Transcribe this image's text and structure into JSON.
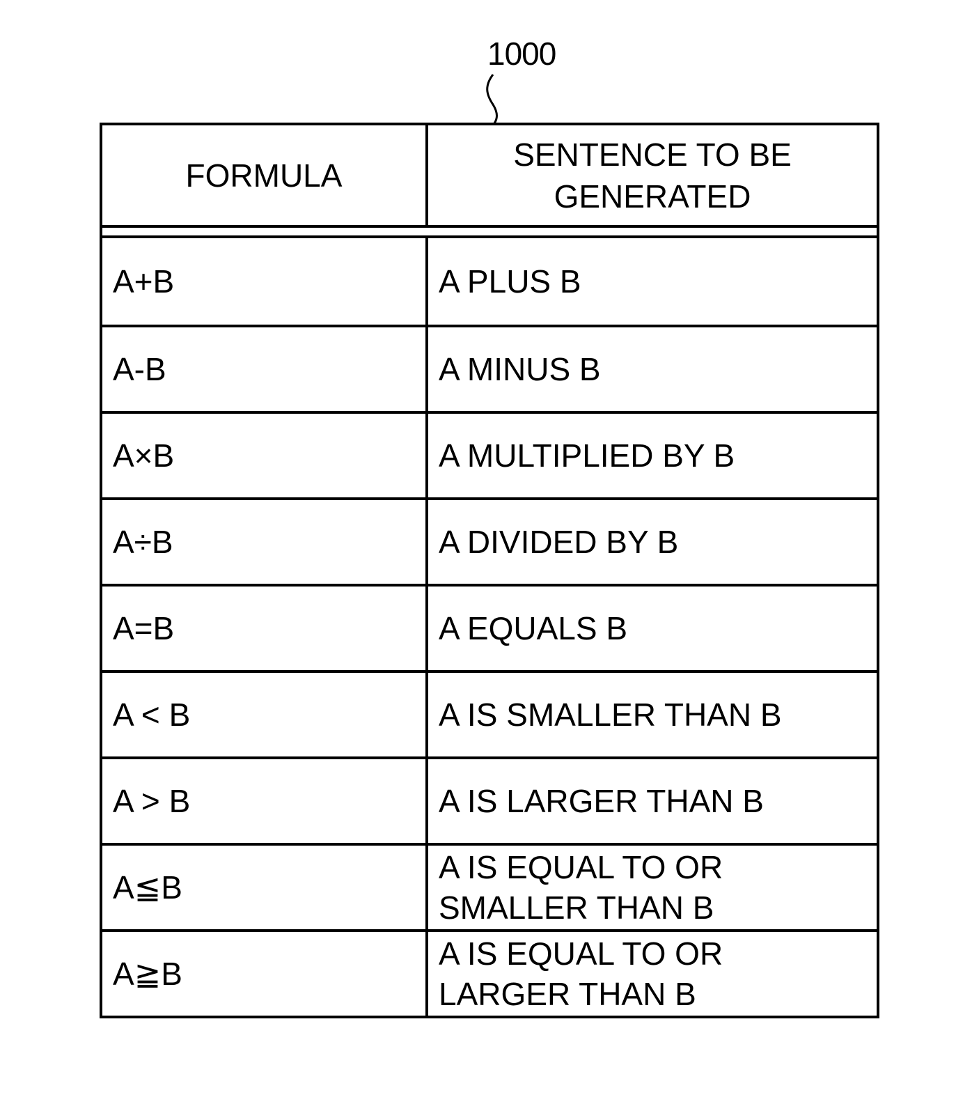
{
  "figure": {
    "reference_numeral": "1000"
  },
  "table": {
    "headers": {
      "formula": "FORMULA",
      "sentence": "SENTENCE TO BE\nGENERATED"
    },
    "rows": [
      {
        "formula": "A+B",
        "sentence": "A PLUS B"
      },
      {
        "formula": "A-B",
        "sentence": "A MINUS B"
      },
      {
        "formula": "A×B",
        "sentence": "A MULTIPLIED BY B"
      },
      {
        "formula": "A÷B",
        "sentence": "A DIVIDED BY B"
      },
      {
        "formula": "A=B",
        "sentence": "A EQUALS B"
      },
      {
        "formula": "A < B",
        "sentence": "A IS SMALLER THAN B"
      },
      {
        "formula": "A > B",
        "sentence": "A IS LARGER THAN B"
      },
      {
        "formula": "A≦B",
        "sentence": "A IS EQUAL TO OR\nSMALLER THAN B"
      },
      {
        "formula": "A≧B",
        "sentence": "A IS EQUAL TO OR\nLARGER THAN B"
      }
    ]
  }
}
